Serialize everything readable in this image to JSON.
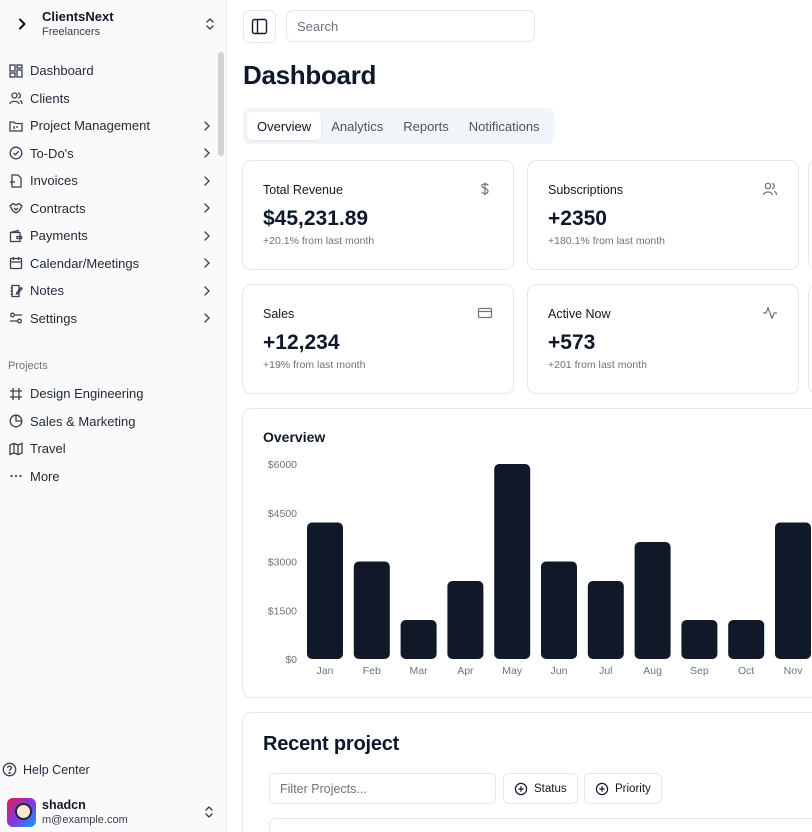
{
  "team": {
    "name": "ClientsNext",
    "plan": "Freelancers"
  },
  "nav": [
    {
      "label": "Dashboard",
      "icon": "layout-dashboard-icon",
      "has_children": false
    },
    {
      "label": "Clients",
      "icon": "users-icon",
      "has_children": false
    },
    {
      "label": "Project Management",
      "icon": "folder-kanban-icon",
      "has_children": true
    },
    {
      "label": "To-Do's",
      "icon": "circle-check-icon",
      "has_children": true
    },
    {
      "label": "Invoices",
      "icon": "file-invoice-icon",
      "has_children": true
    },
    {
      "label": "Contracts",
      "icon": "handshake-icon",
      "has_children": true
    },
    {
      "label": "Payments",
      "icon": "wallet-icon",
      "has_children": true
    },
    {
      "label": "Calendar/Meetings",
      "icon": "calendar-icon",
      "has_children": true
    },
    {
      "label": "Notes",
      "icon": "notebook-pen-icon",
      "has_children": true
    },
    {
      "label": "Settings",
      "icon": "sliders-icon",
      "has_children": true
    }
  ],
  "projects_label": "Projects",
  "projects": [
    {
      "label": "Design Engineering",
      "icon": "frame-icon"
    },
    {
      "label": "Sales & Marketing",
      "icon": "pie-chart-icon"
    },
    {
      "label": "Travel",
      "icon": "map-icon"
    },
    {
      "label": "More",
      "icon": "more-horizontal-icon"
    }
  ],
  "help": {
    "label": "Help Center"
  },
  "user": {
    "name": "shadcn",
    "email": "m@example.com"
  },
  "search": {
    "placeholder": "Search"
  },
  "page_title": "Dashboard",
  "tabs": [
    {
      "label": "Overview",
      "active": true
    },
    {
      "label": "Analytics",
      "active": false
    },
    {
      "label": "Reports",
      "active": false
    },
    {
      "label": "Notifications",
      "active": false
    }
  ],
  "stats": [
    {
      "title": "Total Revenue",
      "value": "$45,231.89",
      "sub": "+20.1% from last month",
      "icon": "dollar-sign-icon"
    },
    {
      "title": "Subscriptions",
      "value": "+2350",
      "sub": "+180.1% from last month",
      "icon": "users-icon"
    },
    {
      "title": "Sales",
      "value": "+12,234",
      "sub": "+19% from last month",
      "icon": "credit-card-icon"
    },
    {
      "title": "Active Now",
      "value": "+573",
      "sub": "+201 from last month",
      "icon": "activity-icon"
    }
  ],
  "overview": {
    "title": "Overview"
  },
  "chart_data": {
    "type": "bar",
    "categories": [
      "Jan",
      "Feb",
      "Mar",
      "Apr",
      "May",
      "Jun",
      "Jul",
      "Aug",
      "Sep",
      "Oct",
      "Nov"
    ],
    "values": [
      4200,
      3000,
      1200,
      2400,
      6000,
      3000,
      2400,
      3600,
      1200,
      1200,
      4200
    ],
    "y_ticks": [
      "$0",
      "$1500",
      "$3000",
      "$4500",
      "$6000"
    ],
    "ylim": [
      0,
      6000
    ],
    "bar_color": "#111827"
  },
  "recent": {
    "title": "Recent project",
    "filter_placeholder": "Filter Projects...",
    "status_label": "Status",
    "priority_label": "Priority"
  }
}
